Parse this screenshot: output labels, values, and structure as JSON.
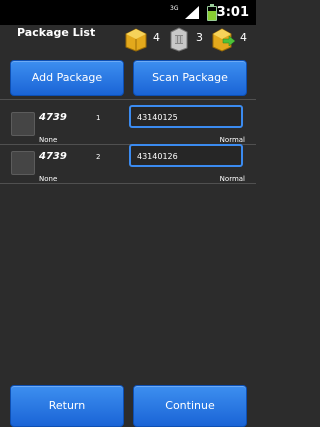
{
  "status": {
    "network": "3G",
    "time": "3:01"
  },
  "header": {
    "title": "Package List",
    "counters": [
      {
        "icon": "package-icon",
        "count": "4"
      },
      {
        "icon": "scanner-icon",
        "count": "3"
      },
      {
        "icon": "package-arrow-icon",
        "count": "4"
      }
    ]
  },
  "actions": {
    "add_label": "Add Package",
    "scan_label": "Scan Package"
  },
  "packages": [
    {
      "code": "4739",
      "index": "1",
      "barcode": "43140125",
      "status_left": "None",
      "status_right": "Normal"
    },
    {
      "code": "4739",
      "index": "2",
      "barcode": "43140126",
      "status_left": "None",
      "status_right": "Normal"
    }
  ],
  "footer": {
    "return_label": "Return",
    "continue_label": "Continue"
  },
  "colors": {
    "accent": "#2a7de8",
    "background": "#2c2c2c",
    "field_border": "#3b8bf0"
  }
}
